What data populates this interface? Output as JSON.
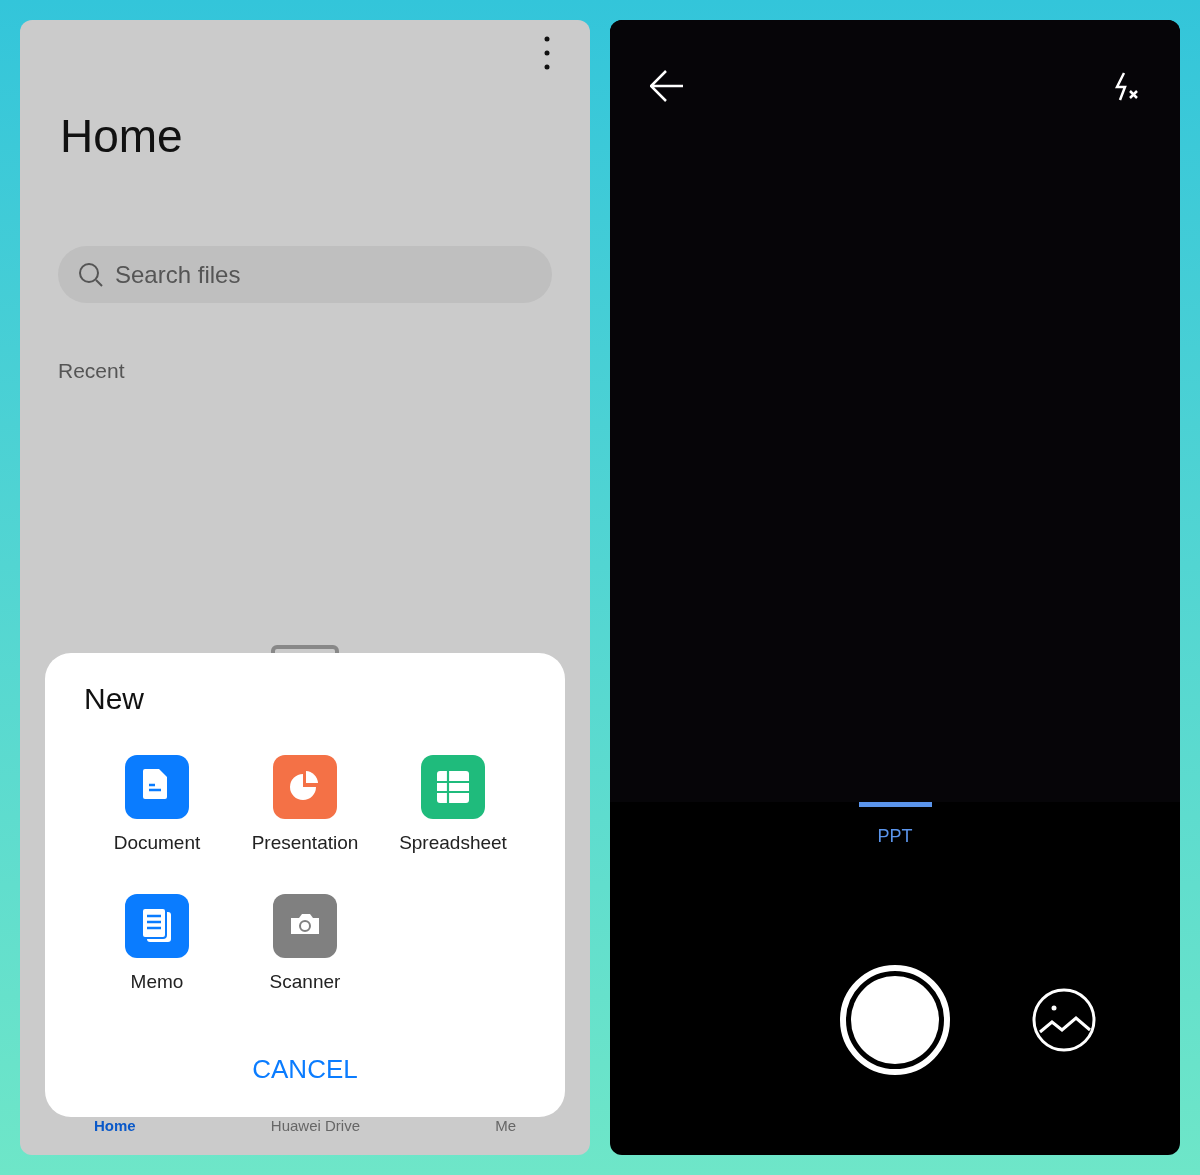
{
  "home": {
    "title": "Home",
    "search": {
      "placeholder": "Search files"
    },
    "section": "Recent",
    "bottom_nav": [
      {
        "label": "Home",
        "selected": true
      },
      {
        "label": "Huawei Drive",
        "selected": false
      },
      {
        "label": "Me",
        "selected": false
      }
    ]
  },
  "new_sheet": {
    "title": "New",
    "items": [
      {
        "label": "Document",
        "kind": "document"
      },
      {
        "label": "Presentation",
        "kind": "presentation"
      },
      {
        "label": "Spreadsheet",
        "kind": "spreadsheet"
      },
      {
        "label": "Memo",
        "kind": "memo"
      },
      {
        "label": "Scanner",
        "kind": "scanner"
      }
    ],
    "cancel": "CANCEL"
  },
  "camera": {
    "modes": [
      {
        "label": "PPT",
        "selected": true
      }
    ]
  }
}
